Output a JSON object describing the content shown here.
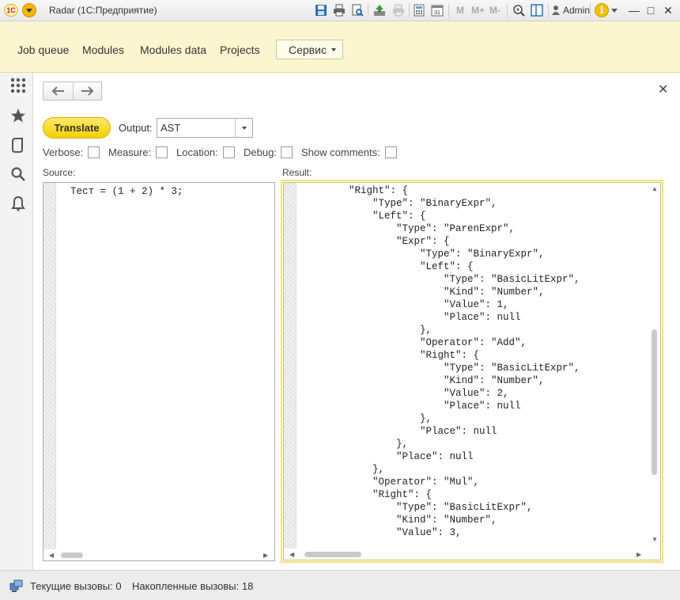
{
  "window": {
    "logo": "1С",
    "title": "Radar  (1С:Предприятие)",
    "user": "Admin",
    "memory_buttons": [
      "M",
      "M+",
      "M-"
    ],
    "info_glyph": "i"
  },
  "sections": {
    "items": [
      {
        "label": "Job queue"
      },
      {
        "label": "Modules"
      },
      {
        "label": "Modules data"
      },
      {
        "label": "Projects"
      }
    ],
    "service_label": "Сервис"
  },
  "form": {
    "translate_label": "Translate",
    "output_label": "Output:",
    "output_value": "AST",
    "options": [
      {
        "label": "Verbose:",
        "checked": false
      },
      {
        "label": "Measure:",
        "checked": false
      },
      {
        "label": "Location:",
        "checked": false
      },
      {
        "label": "Debug:",
        "checked": false
      },
      {
        "label": "Show comments:",
        "checked": false
      }
    ],
    "source_label": "Source:",
    "result_label": "Result:",
    "source_code": "Тест = (1 + 2) * 3;",
    "result_code": "        \"Right\": {\n            \"Type\": \"BinaryExpr\",\n            \"Left\": {\n                \"Type\": \"ParenExpr\",\n                \"Expr\": {\n                    \"Type\": \"BinaryExpr\",\n                    \"Left\": {\n                        \"Type\": \"BasicLitExpr\",\n                        \"Kind\": \"Number\",\n                        \"Value\": 1,\n                        \"Place\": null\n                    },\n                    \"Operator\": \"Add\",\n                    \"Right\": {\n                        \"Type\": \"BasicLitExpr\",\n                        \"Kind\": \"Number\",\n                        \"Value\": 2,\n                        \"Place\": null\n                    },\n                    \"Place\": null\n                },\n                \"Place\": null\n            },\n            \"Operator\": \"Mul\",\n            \"Right\": {\n                \"Type\": \"BasicLitExpr\",\n                \"Kind\": \"Number\",\n                \"Value\": 3,"
  },
  "status": {
    "current_calls": "Текущие вызовы: 0",
    "accumulated_calls": "Накопленные вызовы: 18"
  },
  "icons": {
    "toolbar": [
      "save-icon",
      "print-icon",
      "print-preview-icon",
      "upload-icon",
      "print-disabled-icon",
      "calculator-icon",
      "calendar-icon",
      "zoom-icon",
      "panels-icon"
    ],
    "left": [
      "apps-grid-icon",
      "favorites-star-icon",
      "history-icon",
      "search-icon",
      "notifications-bell-icon"
    ]
  },
  "colors": {
    "accent_yellow": "#f5cf00",
    "sections_bg": "#fbf6d0"
  }
}
